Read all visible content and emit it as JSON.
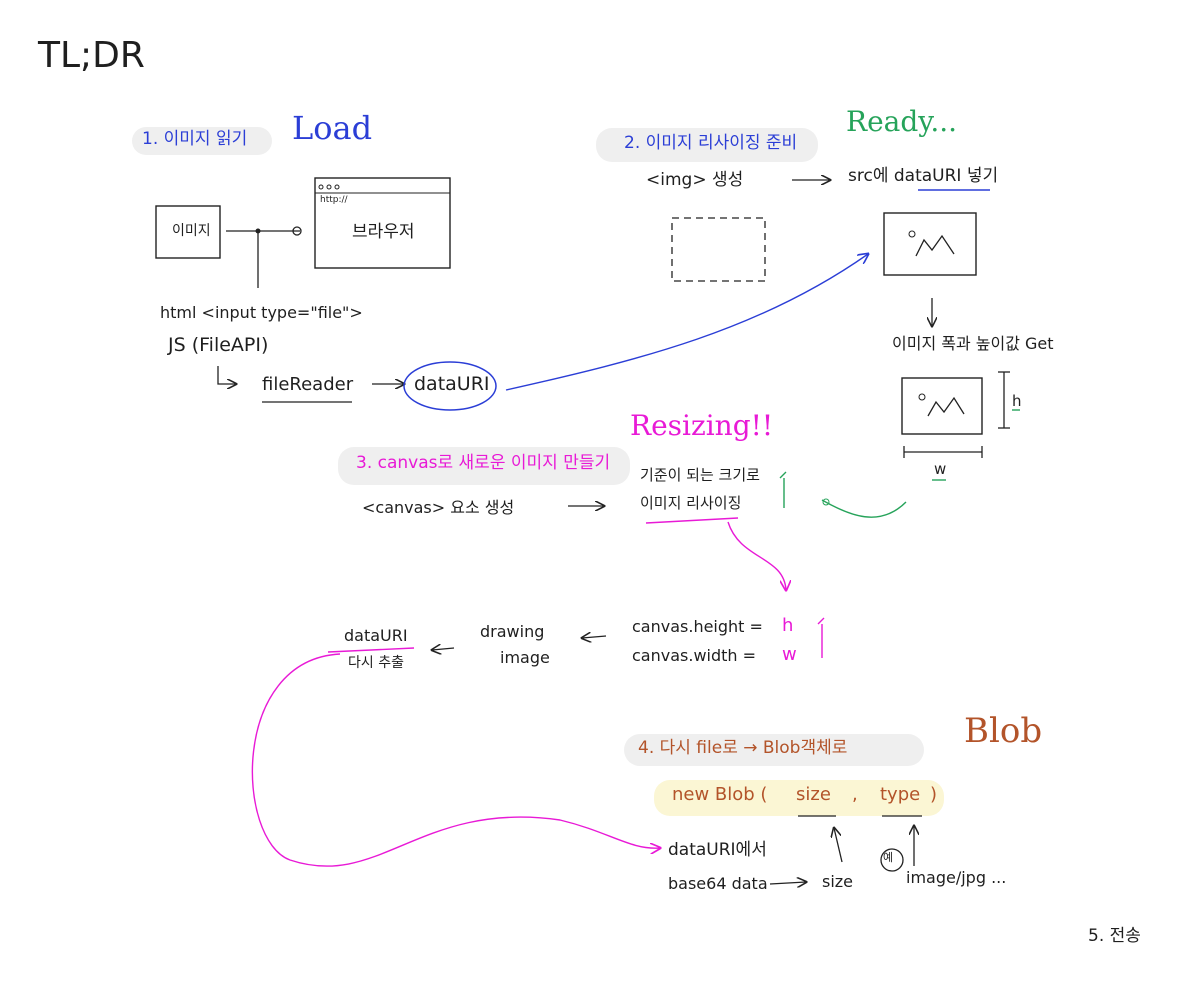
{
  "title": "TL;DR",
  "section1": {
    "heading": "1. 이미지 읽기",
    "tag": "Load",
    "image_box": "이미지",
    "browser_url": "http://",
    "browser_label": "브라우저",
    "html_line": "html <input type=\"file\">",
    "js_line": "JS (FileAPI)",
    "filereader": "fileReader",
    "datauri": "dataURI"
  },
  "section2": {
    "heading": "2. 이미지 리사이징 준비",
    "tag": "Ready...",
    "img_line": "<img> 생성",
    "src_line": "src에 dataURI 넣기",
    "size_get": "이미지 폭과 높이값 Get",
    "h": "h",
    "w": "w"
  },
  "section3": {
    "heading": "3. canvas로 새로운 이미지 만들기",
    "tag": "Resizing!!",
    "canvas_line": "<canvas> 요소 생성",
    "redraw_1": "기준이 되는 크기로",
    "redraw_2": "이미지 리사이징",
    "canvas_height_label": "canvas.height =",
    "canvas_height_value": "h",
    "canvas_width_label": "canvas.width =",
    "canvas_width_value": "w",
    "drawing": "drawing",
    "image": "image",
    "datauri": "dataURI",
    "extract": "다시 추출"
  },
  "section4": {
    "heading": "4. 다시 file로 → Blob객체로",
    "tag": "Blob",
    "blob_new": "new Blob (",
    "blob_size": "size",
    "blob_comma": ",",
    "blob_type": "type",
    "blob_close": ")",
    "datauri_from": "dataURI에서",
    "base64": "base64 data",
    "size": "size",
    "example": "예",
    "mime": "image/jpg ..."
  },
  "section5": {
    "heading": "5. 전송"
  }
}
